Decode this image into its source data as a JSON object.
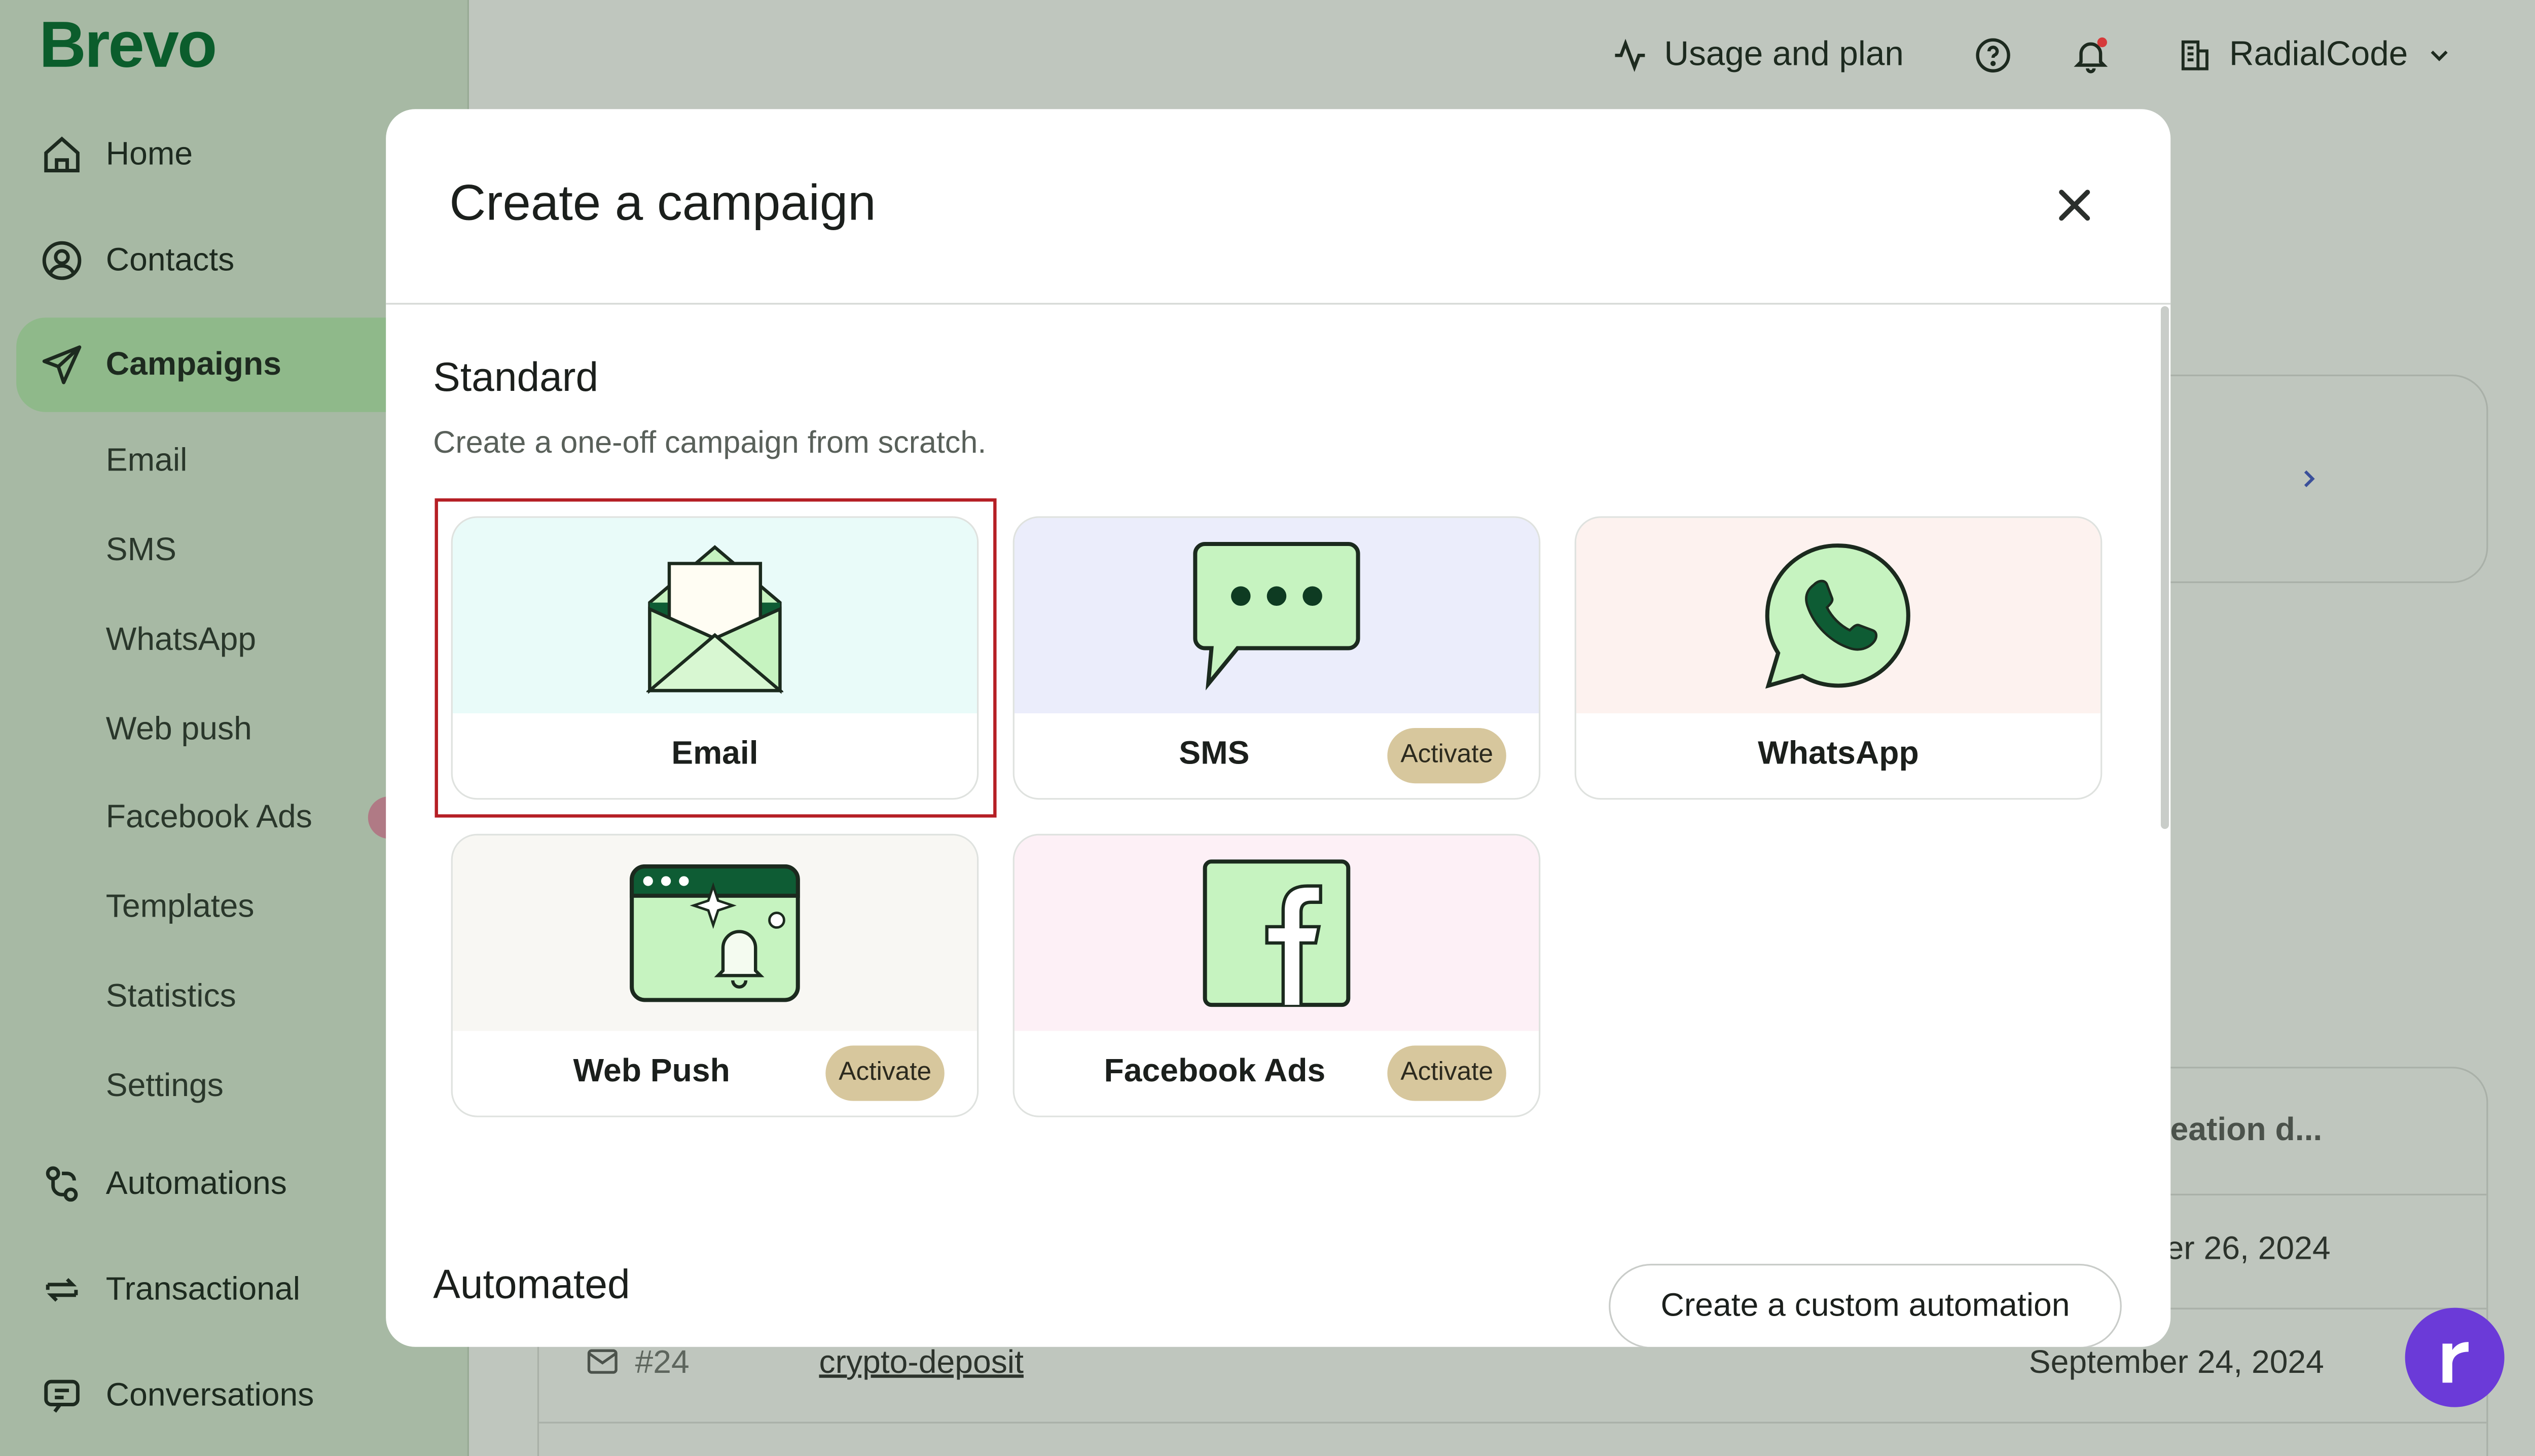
{
  "brand": {
    "logo": "Brevo"
  },
  "sidebar": {
    "items": [
      {
        "label": "Home",
        "icon": "home-icon"
      },
      {
        "label": "Contacts",
        "icon": "contacts-icon"
      },
      {
        "label": "Campaigns",
        "icon": "send-icon",
        "active": true
      },
      {
        "label": "Automations",
        "icon": "automations-icon"
      },
      {
        "label": "Transactional",
        "icon": "transactional-icon"
      },
      {
        "label": "Conversations",
        "icon": "chat-icon"
      }
    ],
    "sub_items": [
      "Email",
      "SMS",
      "WhatsApp",
      "Web push",
      "Facebook Ads",
      "Templates",
      "Statistics",
      "Settings"
    ]
  },
  "topbar": {
    "usage": "Usage and plan",
    "account": "RadialCode"
  },
  "background": {
    "column_header": "reation d...",
    "rows": [
      {
        "date": "er 26, 2024"
      },
      {
        "id": "#24",
        "name": "crypto-deposit",
        "date": "September 24, 2024"
      }
    ]
  },
  "modal": {
    "title": "Create a campaign",
    "standard": {
      "title": "Standard",
      "description": "Create a one-off campaign from scratch."
    },
    "cards": [
      {
        "label": "Email",
        "badge": ""
      },
      {
        "label": "SMS",
        "badge": "Activate"
      },
      {
        "label": "WhatsApp",
        "badge": ""
      },
      {
        "label": "Web Push",
        "badge": "Activate"
      },
      {
        "label": "Facebook Ads",
        "badge": "Activate"
      }
    ],
    "automated": {
      "title": "Automated",
      "button": "Create a custom automation"
    }
  },
  "colors": {
    "brand_green": "#0b5d2c",
    "highlight_red": "#b51f25",
    "badge": "#d7c79d",
    "fab": "#6b3ad8"
  }
}
